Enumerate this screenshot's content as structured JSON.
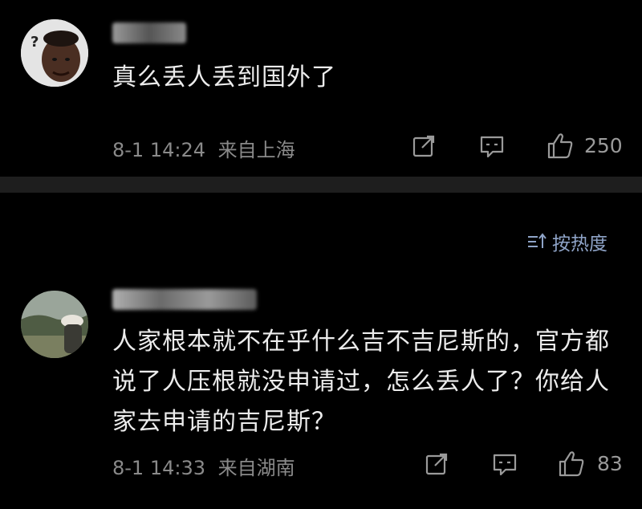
{
  "comments": [
    {
      "username": "晴川",
      "text": "真么丢人丢到国外了",
      "time": "8-1 14:24",
      "location": "来自上海",
      "likes": "250"
    },
    {
      "username": "贾氏",
      "text": "人家根本就不在乎什么吉不吉尼斯的，官方都说了人压根就没申请过，怎么丢人了？你给人家去申请的吉尼斯？",
      "time": "8-1 14:33",
      "location": "来自湖南",
      "likes": "83"
    }
  ],
  "sort": {
    "label": "按热度"
  },
  "colors": {
    "background": "#000000",
    "divider": "#1e1e1e",
    "meta_text": "#8a8a8a",
    "sort_accent": "#8fa4c8"
  },
  "icons": [
    "share-icon",
    "reply-icon",
    "like-icon",
    "sort-icon"
  ]
}
